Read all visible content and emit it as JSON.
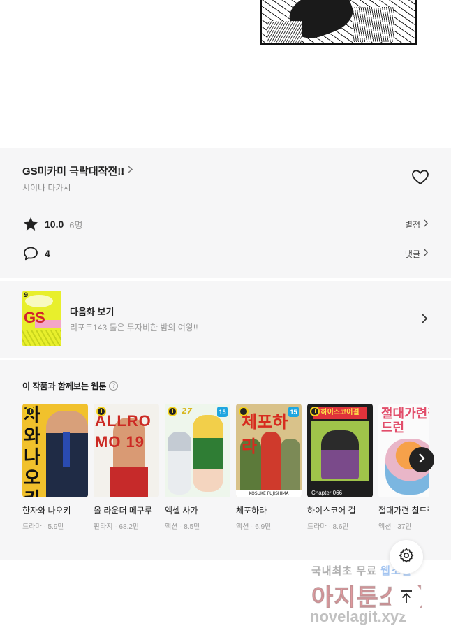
{
  "work": {
    "title": "GS미카미 극락대작전!!",
    "author": "시이나 타카시"
  },
  "rating": {
    "score": "10.0",
    "count": "6명",
    "link_label": "별점"
  },
  "comments": {
    "count": "4",
    "link_label": "댓글"
  },
  "next_episode": {
    "label": "다음화 보기",
    "subtitle": "리포트143 둘은 무자비한 밤의 여왕!!",
    "thumb_volume": "9",
    "thumb_title": "GS"
  },
  "recommendations": {
    "heading": "이 작품과 함께보는 웹툰",
    "help_icon": "?",
    "items": [
      {
        "title": "한자와 나오키",
        "genre": "드라마",
        "views": "5.9만",
        "cover_text": "자와나오키",
        "badge": ""
      },
      {
        "title": "올 라운더 메구루",
        "genre": "판타지",
        "views": "68.2만",
        "cover_text": "ALLRO MO 19",
        "badge": ""
      },
      {
        "title": "엑셀 사가",
        "genre": "액션",
        "views": "8.5만",
        "cover_text": "27",
        "badge": "15"
      },
      {
        "title": "체포하라",
        "genre": "액션",
        "views": "6.9만",
        "cover_text": "체포하라",
        "badge": "15",
        "caption": "KOSUKE FUJISHIMA"
      },
      {
        "title": "하이스코어 걸",
        "genre": "드라마",
        "views": "8.6만",
        "cover_text": "하이스코어걸",
        "badge": "",
        "caption": "Chapter 066"
      },
      {
        "title": "절대가련 칠드런",
        "genre": "액션",
        "views": "37만",
        "cover_text": "절대가련칠드런",
        "badge": ""
      }
    ]
  },
  "watermark": {
    "line1_a": "국내최초 무료 ",
    "line1_b": "웹소설",
    "line2": "아지툰소설",
    "line3": "novelagit.xyz"
  },
  "colors": {
    "panel_bg": "#f6f6f7",
    "text_primary": "#222222",
    "text_secondary": "#999999",
    "badge": "#1ea6e0"
  },
  "icons": {
    "heart": "heart-outline-icon",
    "star": "star-filled-icon",
    "comment": "speech-bubble-icon",
    "settings": "gear-icon",
    "top": "arrow-up-icon"
  }
}
